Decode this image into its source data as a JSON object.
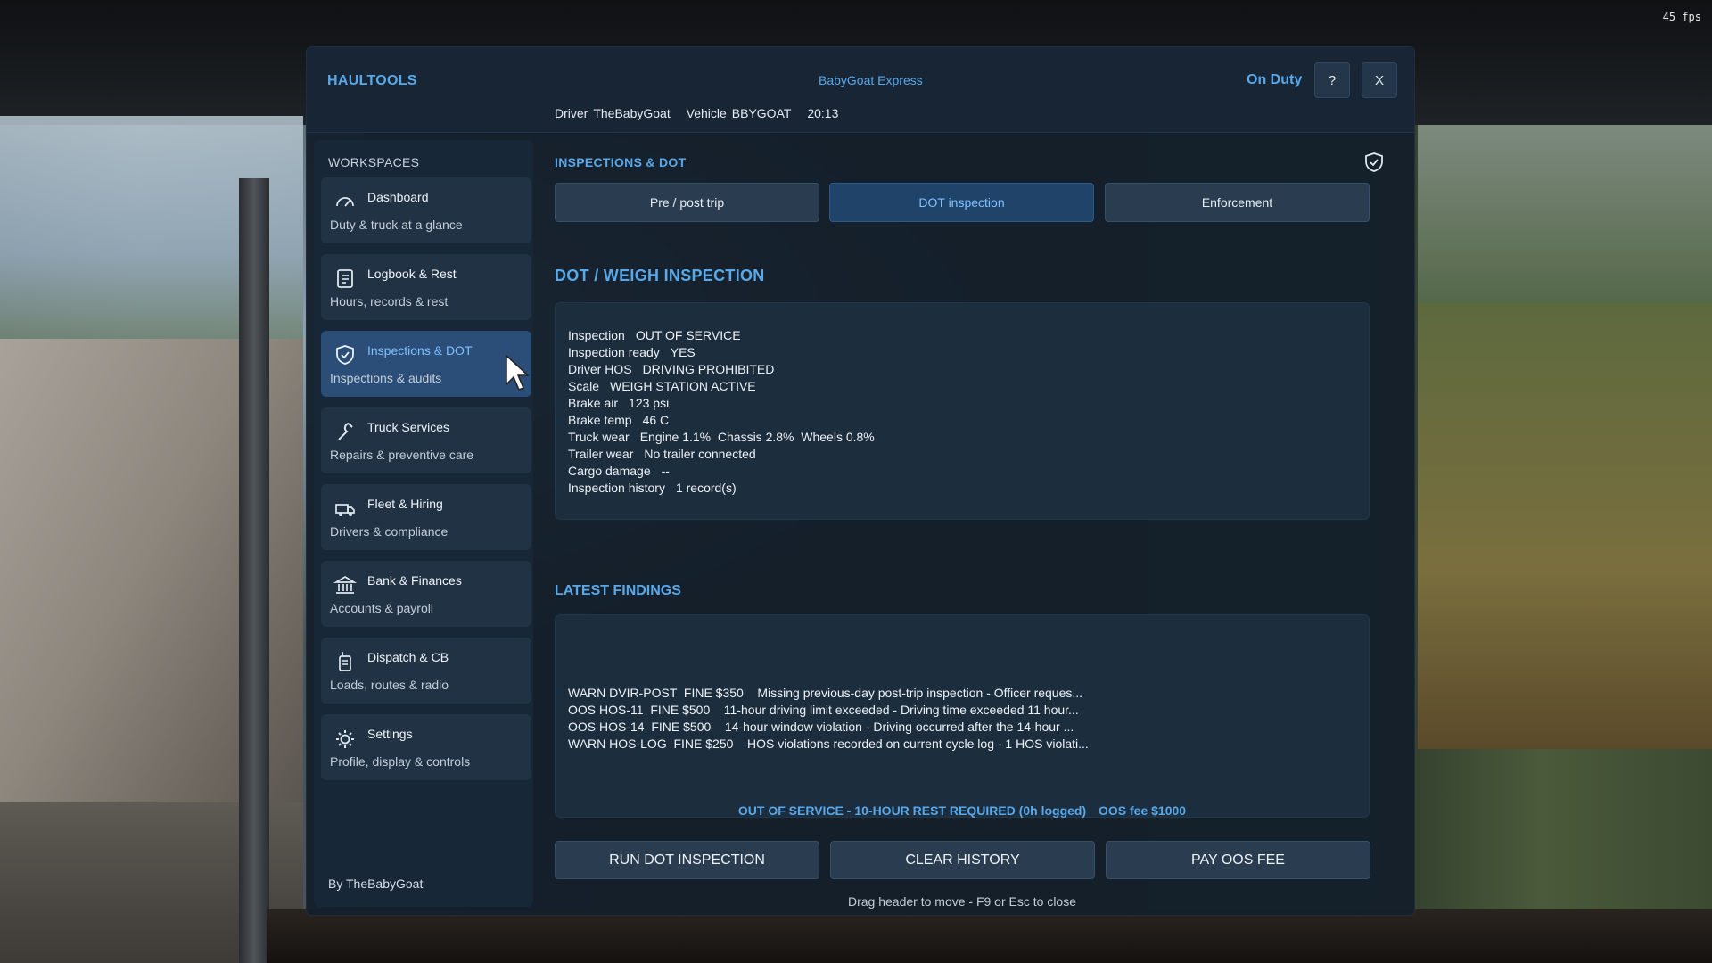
{
  "fps": "45 fps",
  "header": {
    "app_name": "HAULTOOLS",
    "company": "BabyGoat Express",
    "duty_status": "On Duty",
    "help_label": "?",
    "close_label": "X",
    "driver_label": "Driver",
    "driver_value": "TheBabyGoat",
    "vehicle_label": "Vehicle",
    "vehicle_value": "BBYGOAT",
    "time": "20:13"
  },
  "sidebar": {
    "title": "WORKSPACES",
    "items": [
      {
        "label": "Dashboard",
        "sub": "Duty & truck at a glance",
        "icon": "gauge-icon"
      },
      {
        "label": "Logbook & Rest",
        "sub": "Hours, records & rest",
        "icon": "logbook-icon"
      },
      {
        "label": "Inspections & DOT",
        "sub": "Inspections & audits",
        "icon": "shield-icon"
      },
      {
        "label": "Truck Services",
        "sub": "Repairs & preventive care",
        "icon": "wrench-icon"
      },
      {
        "label": "Fleet & Hiring",
        "sub": "Drivers & compliance",
        "icon": "truck-icon"
      },
      {
        "label": "Bank & Finances",
        "sub": "Accounts & payroll",
        "icon": "bank-icon"
      },
      {
        "label": "Dispatch & CB",
        "sub": "Loads, routes & radio",
        "icon": "radio-icon"
      },
      {
        "label": "Settings",
        "sub": "Profile, display & controls",
        "icon": "gear-icon"
      }
    ],
    "active_index": 2,
    "credit": "By TheBabyGoat"
  },
  "main": {
    "section_title": "INSPECTIONS & DOT",
    "tabs": [
      "Pre / post trip",
      "DOT inspection",
      "Enforcement"
    ],
    "active_tab": 1,
    "inspection_title": "DOT / WEIGH INSPECTION",
    "info": [
      {
        "label": "Inspection",
        "value": "OUT OF SERVICE"
      },
      {
        "label": "Inspection ready",
        "value": "YES"
      },
      {
        "label": "Driver HOS",
        "value": "DRIVING PROHIBITED"
      },
      {
        "label": "Scale",
        "value": "WEIGH STATION ACTIVE"
      },
      {
        "label": "Brake air",
        "value": "123 psi"
      },
      {
        "label": "Brake temp",
        "value": "46 C"
      },
      {
        "label": "Truck wear",
        "value": "Engine 1.1%  Chassis 2.8%  Wheels 0.8%"
      },
      {
        "label": "Trailer wear",
        "value": "No trailer connected"
      },
      {
        "label": "Cargo damage",
        "value": "--"
      },
      {
        "label": "Inspection history",
        "value": "1 record(s)"
      }
    ],
    "latest_title": "LATEST FINDINGS",
    "findings": [
      "WARN DVIR-POST  FINE $350    Missing previous-day post-trip inspection - Officer reques...",
      "OOS HOS-11  FINE $500    11-hour driving limit exceeded - Driving time exceeded 11 hour...",
      "OOS HOS-14  FINE $500    14-hour window violation - Driving occurred after the 14-hour ...",
      "WARN HOS-LOG  FINE $250    HOS violations recorded on current cycle log - 1 HOS violati..."
    ],
    "status_text": "OUT OF SERVICE - 10-HOUR REST REQUIRED (0h logged)",
    "oos_fee": "OOS fee $1000",
    "buttons": {
      "run": "RUN DOT INSPECTION",
      "clear": "CLEAR HISTORY",
      "pay": "PAY OOS FEE"
    },
    "hint": "Drag header to move - F9 or Esc to close"
  }
}
